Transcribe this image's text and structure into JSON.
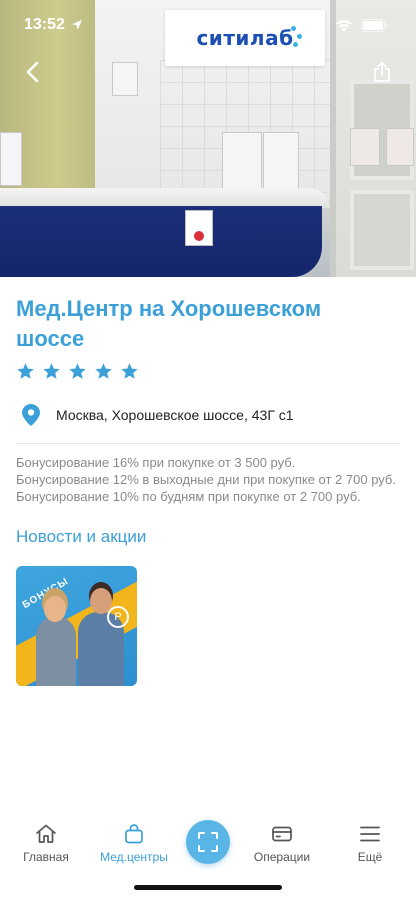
{
  "status_bar": {
    "time": "13:52"
  },
  "hero": {
    "sign_text": "ситилаб",
    "brand_color": "#1b4fb3"
  },
  "clinic": {
    "title": "Мед.Центр на Хорошевском шоссе",
    "rating": 5,
    "address": "Москва, Хорошевское шоссе, 43Г с1"
  },
  "bonus": {
    "lines": [
      "Бонусирование 16% при покупке от 3 500 руб.",
      "Бонусирование 12% в выходные дни при покупке от 2 700 руб.",
      "Бонусирование 10% по будням при покупке от 2 700 руб."
    ]
  },
  "news": {
    "title": "Новости и акции",
    "cards": [
      {
        "label": "БОНУСЫ",
        "coin": "Р"
      }
    ]
  },
  "tabbar": {
    "items": [
      {
        "label": "Главная",
        "icon": "home-icon"
      },
      {
        "label": "Мед.центры",
        "icon": "bag-icon"
      },
      {
        "label": "Операции",
        "icon": "card-icon"
      },
      {
        "label": "Ещё",
        "icon": "menu-icon"
      }
    ],
    "active_color": "#3ba0d8"
  }
}
